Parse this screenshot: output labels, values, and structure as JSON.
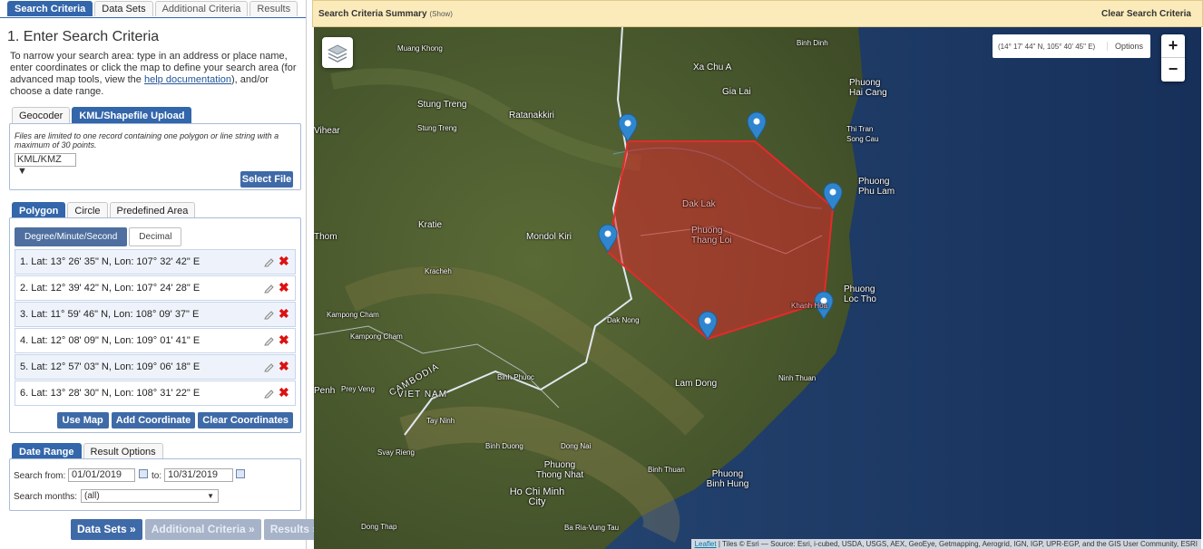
{
  "tabs": [
    "Search Criteria",
    "Data Sets",
    "Additional Criteria",
    "Results"
  ],
  "heading": "1. Enter Search Criteria",
  "intro": {
    "before": "To narrow your search area: type in an address or place name, enter coordinates or click the map to define your search area (for advanced map tools, view the ",
    "link": "help documentation",
    "after": "), and/or choose a date range."
  },
  "geo_tabs": [
    "Geocoder",
    "KML/Shapefile Upload"
  ],
  "geo_note": "Files are limited to one record containing one polygon or line string with a maximum of 30 points.",
  "file_format": "KML/KMZ ▼",
  "select_file": "Select File",
  "poly_tabs": [
    "Polygon",
    "Circle",
    "Predefined Area"
  ],
  "coord_tabs": [
    "Degree/Minute/Second",
    "Decimal"
  ],
  "coordinates": [
    "1.  Lat: 13° 26' 35\" N, Lon: 107° 32' 42\" E",
    "2.  Lat: 12° 39' 42\" N, Lon: 107° 24' 28\" E",
    "3.  Lat: 11° 59' 46\" N, Lon: 108° 09' 37\" E",
    "4.  Lat: 12° 08' 09\" N, Lon: 109° 01' 41\" E",
    "5.  Lat: 12° 57' 03\" N, Lon: 109° 06' 18\" E",
    "6.  Lat: 13° 28' 30\" N, Lon: 108° 31' 22\" E"
  ],
  "coord_buttons": [
    "Use Map",
    "Add Coordinate",
    "Clear Coordinates"
  ],
  "date_tabs": [
    "Date Range",
    "Result Options"
  ],
  "date": {
    "from_label": "Search from:",
    "from": "01/01/2019",
    "to_label": "to:",
    "to": "10/31/2019",
    "months_label": "Search months:",
    "months": "(all)"
  },
  "nav_buttons": [
    "Data Sets »",
    "Additional Criteria »",
    "Results »"
  ],
  "map": {
    "summary_title": "Search Criteria Summary",
    "summary_show": "(Show)",
    "clear": "Clear Search Criteria",
    "coord_display": "(14° 17' 44\" N, 105° 40' 45\" E)",
    "options": "Options",
    "zoom_in": "+",
    "zoom_out": "−",
    "attribution_link": "Leaflet",
    "attribution": " | Tiles © Esri — Source: Esri, i-cubed, USDA, USGS, AEX, GeoEye, Getmapping, Aerogrid, IGN, IGP, UPR-EGP, and the GIS User Community, ESRI",
    "labels": [
      "Muang Khong",
      "Binh Dinh",
      "Xa Chu A",
      "Gia Lai",
      "Phuong Hai Cang",
      "Stung Treng",
      "Stung Treng",
      "Ratanakkiri",
      "Vihear",
      "Thi Tran Song Cau",
      "Phuong Phu Lam",
      "Dak Lak",
      "Kratie",
      "Mondol Kiri",
      "Phuong Thang Loi",
      "Thom",
      "Kracheh",
      "Phuong Loc Tho",
      "Kampong Cham",
      "Dak Nong",
      "Khanh Hoa",
      "Kampong Cham",
      "Binh Phuoc",
      "Ninh Thuan",
      "Prey Veng",
      "Lam Dong",
      "Penh",
      "VIET NAM",
      "CAMBODIA",
      "Tay Ninh",
      "Svay Rieng",
      "Binh Duong",
      "Dong Nai",
      "Phuong Thong Nhat",
      "Binh Thuan",
      "Phuong Binh Hung",
      "Ho Chi Minh City",
      "Dong Thap",
      "Ba Ria-Vung Tau"
    ]
  },
  "colors": {
    "accent": "#3366aa",
    "polygon": "#d9262a",
    "marker": "#2f86cf"
  }
}
